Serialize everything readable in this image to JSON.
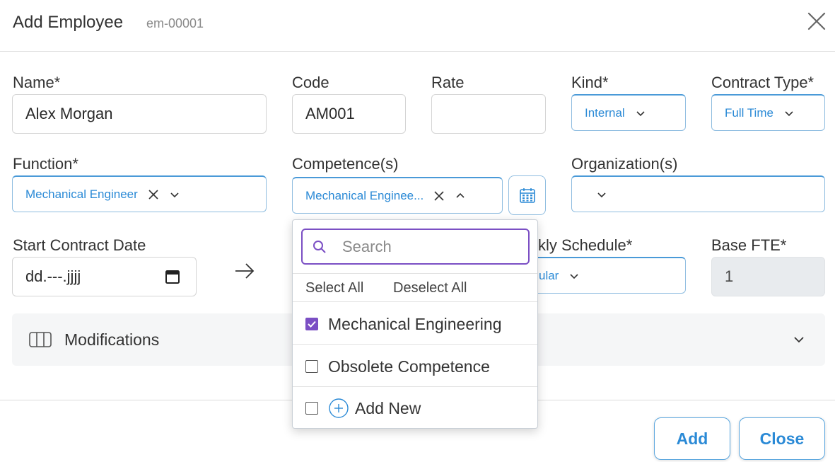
{
  "dialog": {
    "title": "Add Employee",
    "subtitle": "em-00001"
  },
  "fields": {
    "name": {
      "label": "Name*",
      "value": "Alex Morgan"
    },
    "code": {
      "label": "Code",
      "value": "AM001"
    },
    "rate": {
      "label": "Rate",
      "value": ""
    },
    "kind": {
      "label": "Kind*",
      "value": "Internal"
    },
    "contract_type": {
      "label": "Contract Type*",
      "value": "Full Time"
    },
    "function": {
      "label": "Function*",
      "value": "Mechanical Engineer"
    },
    "competences": {
      "label": "Competence(s)",
      "value": "Mechanical Enginee..."
    },
    "organizations": {
      "label": "Organization(s)",
      "value": ""
    },
    "start_contract_date": {
      "label": "Start Contract Date",
      "value": "dd.---.jjjj"
    },
    "weekly_schedule": {
      "label": "kly Schedule*",
      "value": "ular"
    },
    "base_fte": {
      "label": "Base FTE*",
      "value": "1"
    }
  },
  "accordion": {
    "label": "Modifications"
  },
  "dropdown": {
    "search_placeholder": "Search",
    "select_all": "Select All",
    "deselect_all": "Deselect All",
    "options": [
      {
        "label": "Mechanical Engineering",
        "checked": true
      },
      {
        "label": "Obsolete Competence",
        "checked": false
      }
    ],
    "add_new": "Add New"
  },
  "buttons": {
    "add": "Add",
    "close": "Close"
  },
  "colors": {
    "accent_blue": "#2b8ad6",
    "checkbox_purple": "#7b4fc4"
  }
}
